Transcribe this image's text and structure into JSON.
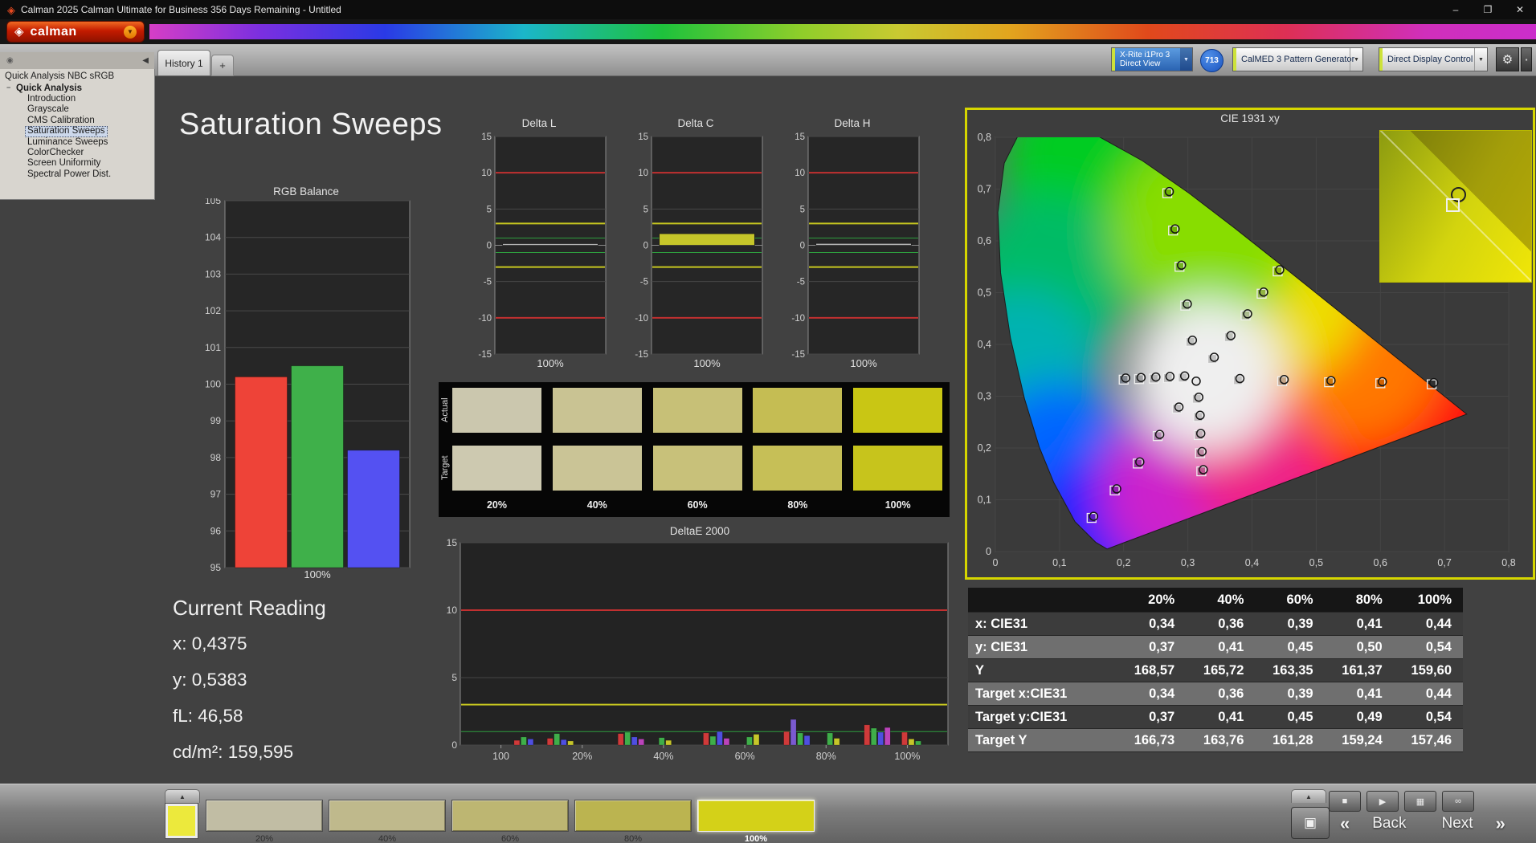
{
  "window": {
    "title": "Calman 2025 Calman Ultimate for Business 356 Days Remaining  - Untitled",
    "minimize": "–",
    "maximize": "❐",
    "close": "✕"
  },
  "icons": {
    "app": "◈",
    "logo_diamond": "◈",
    "caret_down": "▼",
    "gear": "⚙",
    "edge": "▪",
    "options": "◉",
    "collapse": "◀",
    "expander": "−",
    "up": "▲",
    "stop": "■",
    "play": "▶",
    "save": "▦",
    "link": "∞",
    "pattern_window": "▣"
  },
  "brand": {
    "name": "calman"
  },
  "tabs": {
    "active": "History 1",
    "add": "+"
  },
  "toolbar": {
    "meter_line1": "X-Rite i1Pro 3",
    "meter_line2": "Direct View",
    "meter_badge": "713",
    "pattern_generator": "CalMED 3 Pattern Generator",
    "display_control": "Direct Display Control"
  },
  "sidebar": {
    "header": "Quick Analysis NBC sRGB",
    "root": "Quick Analysis",
    "selected": "Saturation Sweeps",
    "items": [
      "Introduction",
      "Grayscale",
      "CMS Calibration",
      "Saturation Sweeps",
      "Luminance Sweeps",
      "ColorChecker",
      "Screen Uniformity",
      "Spectral Power Dist."
    ]
  },
  "page": {
    "title": "Saturation Sweeps"
  },
  "current_reading": {
    "title": "Current Reading",
    "x": "x: 0,4375",
    "y": "y: 0,5383",
    "fl": "fL: 46,58",
    "cd": "cd/m²: 159,595"
  },
  "swatch_grid": {
    "row_labels": [
      "Actual",
      "Target"
    ],
    "col_labels": [
      "20%",
      "40%",
      "60%",
      "80%",
      "100%"
    ],
    "actual": [
      "#cbc7ae",
      "#c9c393",
      "#c7c077",
      "#c5bd53",
      "#c9c614"
    ],
    "target": [
      "#cdc9b0",
      "#cac496",
      "#c8c17a",
      "#c6bf57",
      "#c7c41c"
    ]
  },
  "chart_data": [
    {
      "id": "rgb_balance",
      "type": "bar",
      "title": "RGB Balance",
      "categories": [
        "100%"
      ],
      "ylim": [
        95,
        105
      ],
      "yticks": [
        105,
        104,
        103,
        102,
        101,
        100,
        99,
        98,
        97,
        96,
        95
      ],
      "series": [
        {
          "name": "Red",
          "values": [
            100.2
          ],
          "color": "#ee4338"
        },
        {
          "name": "Green",
          "values": [
            100.5
          ],
          "color": "#3fb04a"
        },
        {
          "name": "Blue",
          "values": [
            98.2
          ],
          "color": "#5451f2"
        }
      ]
    },
    {
      "id": "delta_l",
      "type": "bar",
      "title": "Delta L",
      "xlabel": "100%",
      "ylim": [
        -15,
        15
      ],
      "yticks": [
        15,
        10,
        5,
        0,
        -5,
        -10,
        -15
      ],
      "values": [
        0.2
      ],
      "bar_color": "#b5b5b5",
      "limits": [
        {
          "y": 10,
          "color": "#c23030",
          "w": 2
        },
        {
          "y": -10,
          "color": "#c23030",
          "w": 2
        },
        {
          "y": 3,
          "color": "#c6c620",
          "w": 2
        },
        {
          "y": -3,
          "color": "#c6c620",
          "w": 2
        },
        {
          "y": 1,
          "color": "#2e9e3e",
          "w": 1
        },
        {
          "y": -1,
          "color": "#2e9e3e",
          "w": 1
        }
      ]
    },
    {
      "id": "delta_c",
      "type": "bar",
      "title": "Delta C",
      "xlabel": "100%",
      "ylim": [
        -15,
        15
      ],
      "yticks": [
        15,
        10,
        5,
        0,
        -5,
        -10,
        -15
      ],
      "values": [
        1.6
      ],
      "bar_color": "#c6c62a",
      "limits": [
        {
          "y": 10,
          "color": "#c23030",
          "w": 2
        },
        {
          "y": -10,
          "color": "#c23030",
          "w": 2
        },
        {
          "y": 3,
          "color": "#c6c620",
          "w": 2
        },
        {
          "y": -3,
          "color": "#c6c620",
          "w": 2
        },
        {
          "y": 1,
          "color": "#2e9e3e",
          "w": 1
        },
        {
          "y": -1,
          "color": "#2e9e3e",
          "w": 1
        }
      ]
    },
    {
      "id": "delta_h",
      "type": "bar",
      "title": "Delta H",
      "xlabel": "100%",
      "ylim": [
        -15,
        15
      ],
      "yticks": [
        15,
        10,
        5,
        0,
        -5,
        -10,
        -15
      ],
      "values": [
        0.25
      ],
      "bar_color": "#b5b5b5",
      "limits": [
        {
          "y": 10,
          "color": "#c23030",
          "w": 2
        },
        {
          "y": -10,
          "color": "#c23030",
          "w": 2
        },
        {
          "y": 3,
          "color": "#c6c620",
          "w": 2
        },
        {
          "y": -3,
          "color": "#c6c620",
          "w": 2
        },
        {
          "y": 1,
          "color": "#2e9e3e",
          "w": 1
        },
        {
          "y": -1,
          "color": "#2e9e3e",
          "w": 1
        }
      ]
    },
    {
      "id": "deltae2000",
      "type": "bar",
      "title": "DeltaE 2000",
      "ylim": [
        0,
        15
      ],
      "yticks": [
        0,
        5,
        10,
        15
      ],
      "xticklabels": [
        "100",
        "20%",
        "40%",
        "60%",
        "80%",
        "100%"
      ],
      "limits": [
        {
          "y": 10,
          "color": "#c23030",
          "w": 2
        },
        {
          "y": 3,
          "color": "#c6c620",
          "w": 2
        },
        {
          "y": 1,
          "color": "#2e9e3e",
          "w": 1
        }
      ],
      "groups": [
        {
          "pos": 0.13,
          "bars": [
            {
              "color": "#cf3a3a",
              "h": 0.35
            },
            {
              "color": "#3fae4a",
              "h": 0.6
            },
            {
              "color": "#4f4fe0",
              "h": 0.45
            }
          ]
        },
        {
          "pos": 0.205,
          "bars": [
            {
              "color": "#cf3a3a",
              "h": 0.5
            },
            {
              "color": "#3fae4a",
              "h": 0.85
            },
            {
              "color": "#4f4fe0",
              "h": 0.4
            },
            {
              "color": "#c6c62a",
              "h": 0.3
            }
          ]
        },
        {
          "pos": 0.35,
          "bars": [
            {
              "color": "#cf3a3a",
              "h": 0.85
            },
            {
              "color": "#3fae4a",
              "h": 0.95
            },
            {
              "color": "#4f4fe0",
              "h": 0.6
            },
            {
              "color": "#bb44bb",
              "h": 0.45
            }
          ]
        },
        {
          "pos": 0.42,
          "bars": [
            {
              "color": "#3fae4a",
              "h": 0.55
            },
            {
              "color": "#c6c62a",
              "h": 0.35
            }
          ]
        },
        {
          "pos": 0.525,
          "bars": [
            {
              "color": "#cf3a3a",
              "h": 0.9
            },
            {
              "color": "#3fae4a",
              "h": 0.65
            },
            {
              "color": "#4f4fe0",
              "h": 1.0
            },
            {
              "color": "#bb44bb",
              "h": 0.5
            }
          ]
        },
        {
          "pos": 0.6,
          "bars": [
            {
              "color": "#3fae4a",
              "h": 0.6
            },
            {
              "color": "#c6c62a",
              "h": 0.8
            }
          ]
        },
        {
          "pos": 0.69,
          "bars": [
            {
              "color": "#cf3a3a",
              "h": 1.0
            },
            {
              "color": "#7a5ad0",
              "h": 1.9
            },
            {
              "color": "#3fae4a",
              "h": 0.9
            },
            {
              "color": "#4f4fe0",
              "h": 0.7
            }
          ]
        },
        {
          "pos": 0.765,
          "bars": [
            {
              "color": "#3fae4a",
              "h": 0.9
            },
            {
              "color": "#c6c62a",
              "h": 0.5
            }
          ]
        },
        {
          "pos": 0.855,
          "bars": [
            {
              "color": "#cf3a3a",
              "h": 1.5
            },
            {
              "color": "#3fae4a",
              "h": 1.25
            },
            {
              "color": "#4f4fe0",
              "h": 0.95
            },
            {
              "color": "#bb44bb",
              "h": 1.3
            }
          ]
        },
        {
          "pos": 0.925,
          "bars": [
            {
              "color": "#cf3a3a",
              "h": 0.95
            },
            {
              "color": "#c6c62a",
              "h": 0.45
            },
            {
              "color": "#3fae4a",
              "h": 0.3
            }
          ]
        }
      ]
    },
    {
      "id": "cie",
      "type": "scatter",
      "title": "CIE 1931 xy",
      "xlim": [
        0,
        0.8
      ],
      "ylim": [
        0,
        0.8
      ],
      "xticks": [
        "0",
        "0,1",
        "0,2",
        "0,3",
        "0,4",
        "0,5",
        "0,6",
        "0,7",
        "0,8"
      ],
      "yticks": [
        "0",
        "0,1",
        "0,2",
        "0,3",
        "0,4",
        "0,5",
        "0,6",
        "0,7",
        "0,8"
      ],
      "white_point": [
        0.313,
        0.329
      ],
      "sweeps": [
        {
          "name": "red",
          "points": [
            [
              0.378,
              0.331
            ],
            [
              0.447,
              0.329
            ],
            [
              0.52,
              0.327
            ],
            [
              0.6,
              0.325
            ],
            [
              0.68,
              0.323
            ]
          ]
        },
        {
          "name": "green",
          "points": [
            [
              0.304,
              0.405
            ],
            [
              0.296,
              0.475
            ],
            [
              0.287,
              0.55
            ],
            [
              0.277,
              0.62
            ],
            [
              0.268,
              0.692
            ]
          ]
        },
        {
          "name": "blue",
          "points": [
            [
              0.283,
              0.276
            ],
            [
              0.253,
              0.223
            ],
            [
              0.222,
              0.17
            ],
            [
              0.186,
              0.118
            ],
            [
              0.15,
              0.065
            ]
          ]
        },
        {
          "name": "cyan",
          "points": [
            [
              0.292,
              0.336
            ],
            [
              0.269,
              0.335
            ],
            [
              0.247,
              0.334
            ],
            [
              0.224,
              0.333
            ],
            [
              0.2,
              0.332
            ]
          ]
        },
        {
          "name": "magenta",
          "points": [
            [
              0.314,
              0.295
            ],
            [
              0.316,
              0.26
            ],
            [
              0.317,
              0.225
            ],
            [
              0.319,
              0.19
            ],
            [
              0.321,
              0.155
            ]
          ]
        },
        {
          "name": "yellow",
          "points": [
            [
              0.338,
              0.372
            ],
            [
              0.364,
              0.414
            ],
            [
              0.39,
              0.456
            ],
            [
              0.415,
              0.498
            ],
            [
              0.44,
              0.541
            ]
          ]
        }
      ]
    }
  ],
  "table": {
    "headers": [
      "",
      "20%",
      "40%",
      "60%",
      "80%",
      "100%"
    ],
    "rows": [
      [
        "x: CIE31",
        "0,34",
        "0,36",
        "0,39",
        "0,41",
        "0,44"
      ],
      [
        "y: CIE31",
        "0,37",
        "0,41",
        "0,45",
        "0,50",
        "0,54"
      ],
      [
        "Y",
        "168,57",
        "165,72",
        "163,35",
        "161,37",
        "159,60"
      ],
      [
        "Target x:CIE31",
        "0,34",
        "0,36",
        "0,39",
        "0,41",
        "0,44"
      ],
      [
        "Target y:CIE31",
        "0,37",
        "0,41",
        "0,45",
        "0,49",
        "0,54"
      ],
      [
        "Target Y",
        "166,73",
        "163,76",
        "161,28",
        "159,24",
        "157,46"
      ]
    ]
  },
  "bottom_bar": {
    "patch_color": "#ece93c",
    "active_index": 4,
    "swatches": [
      {
        "label": "20%",
        "color": "#c1bda4"
      },
      {
        "label": "40%",
        "color": "#bfb98c"
      },
      {
        "label": "60%",
        "color": "#bdb672"
      },
      {
        "label": "80%",
        "color": "#bbb450"
      },
      {
        "label": "100%",
        "color": "#d4d118"
      }
    ],
    "chevron_left": "«",
    "back": "Back",
    "next": "Next",
    "chevron_right": "»"
  }
}
